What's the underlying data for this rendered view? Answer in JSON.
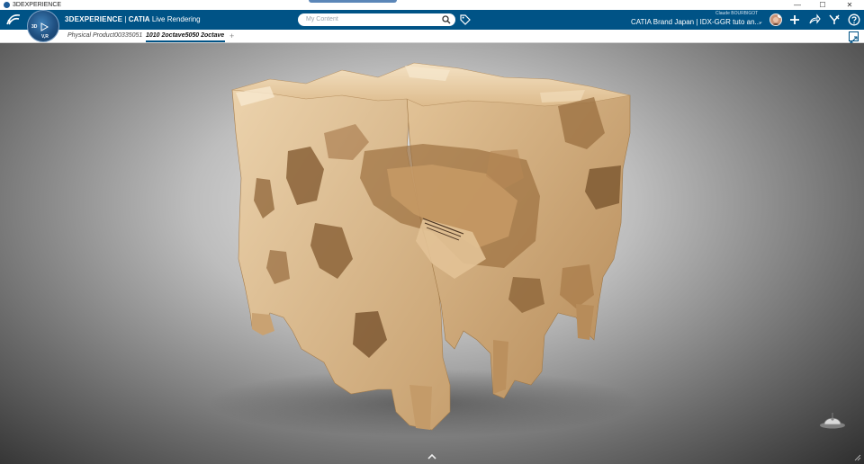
{
  "window": {
    "title": "3DEXPERIENCE",
    "minimize": "—",
    "maximize": "☐",
    "close": "✕"
  },
  "header": {
    "brand_main": "3DEXPERIENCE",
    "brand_sep": " | ",
    "brand_app": "CATIA",
    "brand_role": " Live Rendering",
    "search_placeholder": "My Content",
    "user_name": "Claude BOURBIGOT",
    "tenant": "CATIA Brand Japan | IDX-GGR tuto an...",
    "compass_3d": "3D",
    "compass_vr": "V,R"
  },
  "tabs": [
    {
      "label": "Physical Product00335051"
    },
    {
      "label": "1010 2octave5050 2octave",
      "active": true
    }
  ],
  "tab_add": "+",
  "icons": [
    "ds-logo-icon",
    "search-icon",
    "tag-icon",
    "chevron-down-icon",
    "plus-icon",
    "share-icon",
    "tools-icon",
    "help-icon",
    "maximize-viewer-icon",
    "robot-icon",
    "expand-up-icon"
  ],
  "colors": {
    "header": "#005386",
    "model": "#d9b88a"
  }
}
